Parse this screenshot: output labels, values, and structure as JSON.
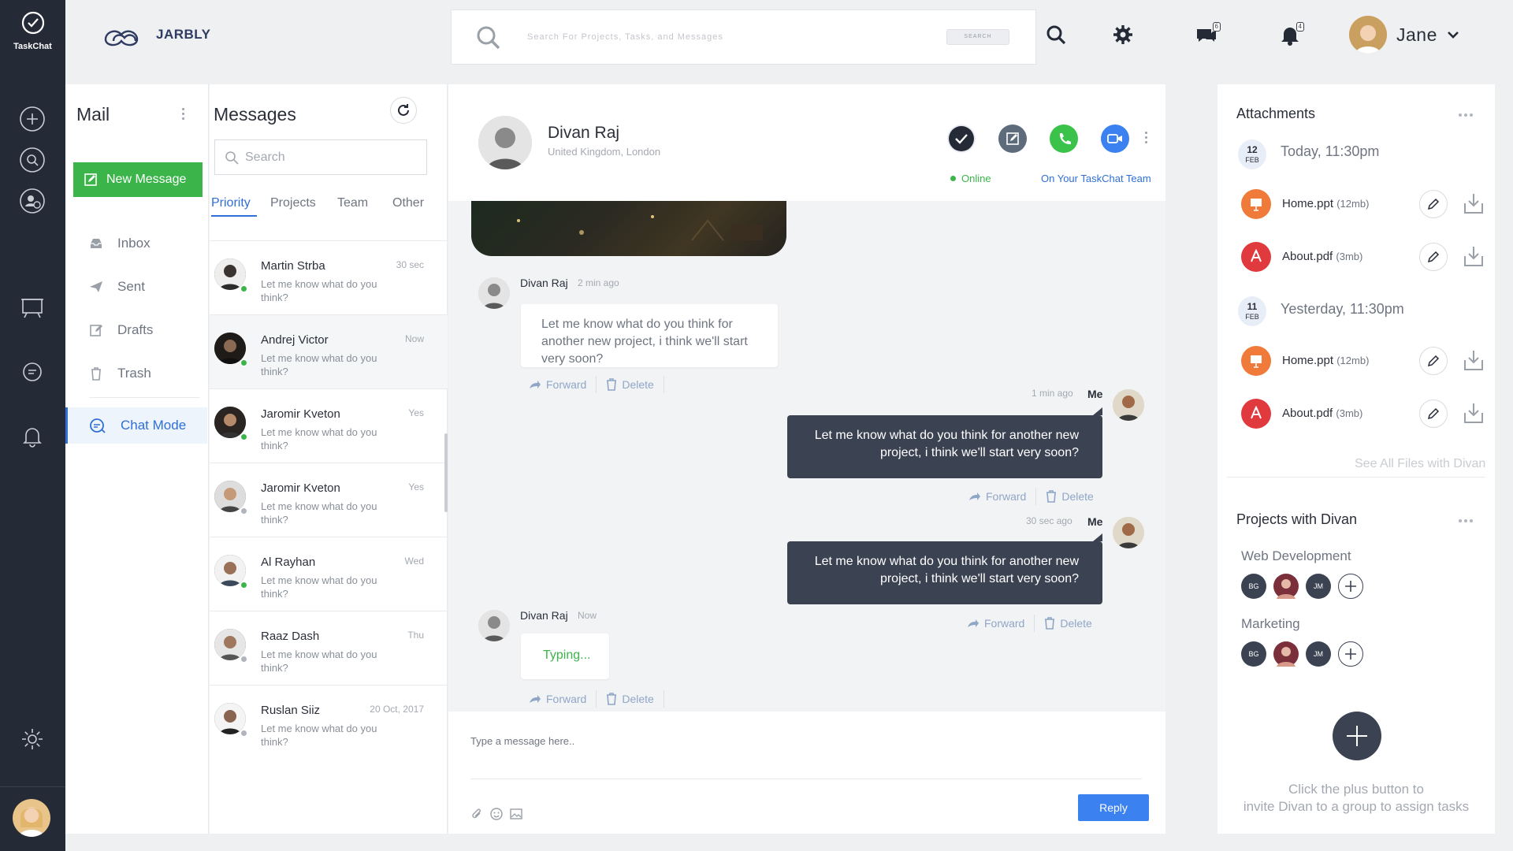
{
  "app": {
    "rail_label": "TaskChat"
  },
  "brand": {
    "name": "JARBLY"
  },
  "search": {
    "placeholder": "Search For Projects, Tasks, and Messages",
    "button": "SEARCH"
  },
  "header": {
    "chat_badge": "6",
    "notif_badge": "4",
    "user_name": "Jane"
  },
  "mail": {
    "title": "Mail",
    "new_message": "New Message",
    "items": [
      {
        "label": "Inbox",
        "icon": "inbox-icon"
      },
      {
        "label": "Sent",
        "icon": "send-icon"
      },
      {
        "label": "Drafts",
        "icon": "drafts-icon"
      },
      {
        "label": "Trash",
        "icon": "trash-icon"
      },
      {
        "label": "Chat Mode",
        "icon": "chat-icon",
        "active": true
      }
    ]
  },
  "messages": {
    "title": "Messages",
    "search_placeholder": "Search",
    "tabs": [
      "Priority",
      "Projects",
      "Team",
      "Other"
    ],
    "active_tab": "Priority",
    "conversations": [
      {
        "name": "Martin Strba",
        "time": "30 sec",
        "preview": "Let me know what do you think?",
        "status": "online"
      },
      {
        "name": "Andrej Victor",
        "time": "Now",
        "preview": "Let me know what do you think?",
        "status": "online"
      },
      {
        "name": "Jaromir Kveton",
        "time": "Yes",
        "preview": "Let me know what do you think?",
        "status": "online"
      },
      {
        "name": "Jaromir Kveton",
        "time": "Yes",
        "preview": "Let me know what do you think?",
        "status": "offline"
      },
      {
        "name": "Al Rayhan",
        "time": "Wed",
        "preview": "Let me know what do you think?",
        "status": "online"
      },
      {
        "name": "Raaz Dash",
        "time": "Thu",
        "preview": "Let me know what do you think?",
        "status": "offline"
      },
      {
        "name": "Ruslan Siiz",
        "time": "20 Oct, 2017",
        "preview": "Let me know what do you think?",
        "status": "offline"
      }
    ]
  },
  "chat": {
    "contact_name": "Divan Raj",
    "contact_location": "United Kingdom, London",
    "status": "Online",
    "team_link": "On Your TaskChat Team",
    "messages": [
      {
        "sender": "Divan Raj",
        "time": "2 min ago",
        "text": "Let me know what do you think for another new project, i think we'll start very soon?"
      },
      {
        "sender": "Me",
        "time": "1 min ago",
        "text": "Let me know what do you think for another new project, i think we'll start very soon?"
      },
      {
        "sender": "Me",
        "time": "30 sec ago",
        "text": "Let me know what do you think for another new project, i think we'll start very soon?"
      },
      {
        "sender": "Divan Raj",
        "time": "Now",
        "text": "Typing..."
      }
    ],
    "forward": "Forward",
    "delete": "Delete",
    "composer_placeholder": "Type a message here..",
    "reply": "Reply"
  },
  "attachments": {
    "title": "Attachments",
    "groups": [
      {
        "day": "12",
        "month": "FEB",
        "label": "Today, 11:30pm",
        "files": [
          {
            "name": "Home.ppt",
            "size": "(12mb)",
            "type": "ppt"
          },
          {
            "name": "About.pdf",
            "size": "(3mb)",
            "type": "pdf"
          }
        ]
      },
      {
        "day": "11",
        "month": "FEB",
        "label": "Yesterday, 11:30pm",
        "files": [
          {
            "name": "Home.ppt",
            "size": "(12mb)",
            "type": "ppt"
          },
          {
            "name": "About.pdf",
            "size": "(3mb)",
            "type": "pdf"
          }
        ]
      }
    ],
    "see_all": "See All Files with Divan"
  },
  "projects": {
    "title": "Projects with Divan",
    "list": [
      {
        "name": "Web Development",
        "members": [
          "BG",
          "",
          "JM"
        ]
      },
      {
        "name": "Marketing",
        "members": [
          "BG",
          "",
          "JM"
        ]
      }
    ],
    "invite_line1": "Click the plus button to",
    "invite_line2": "invite Divan to a group to assign tasks"
  },
  "colors": {
    "accent": "#2f6fd6",
    "green": "#3bb54a",
    "dark": "#252a37",
    "bubble": "#3b4252",
    "ppt": "#f07a3a",
    "pdf": "#e0393e"
  }
}
